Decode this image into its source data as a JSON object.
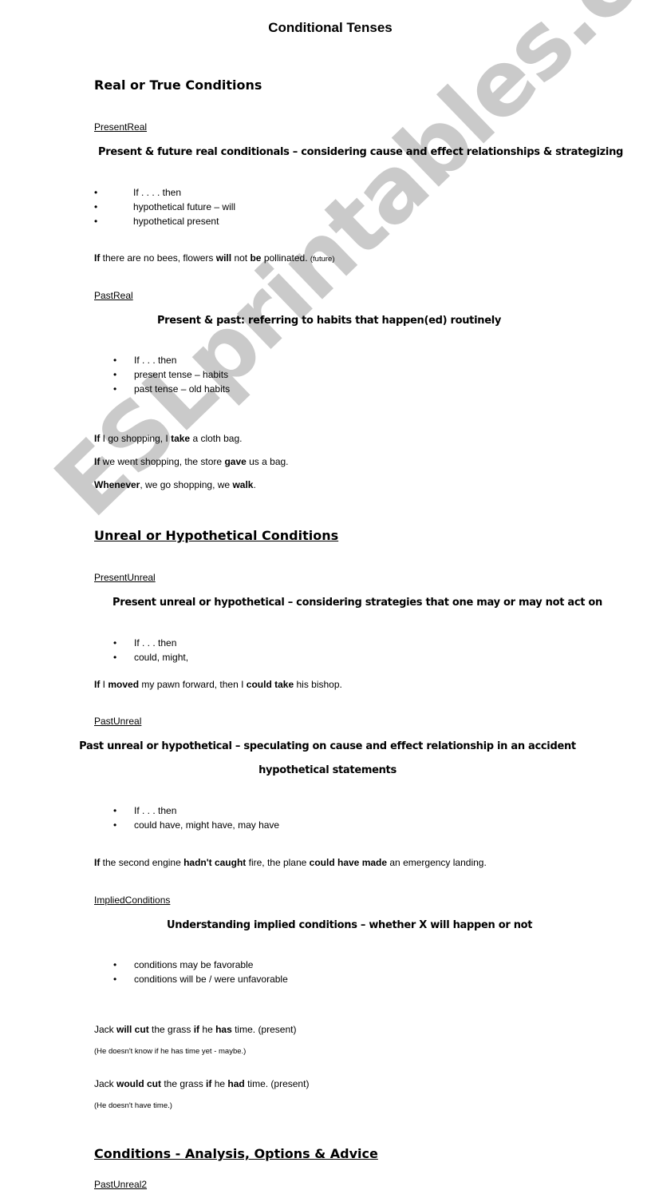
{
  "watermark": "ESLprintables.com",
  "title": "Conditional Tenses",
  "sections": {
    "real": {
      "heading": "Real or True Conditions",
      "present_real": {
        "link": "PresentReal",
        "desc": "Present & future real conditionals – considering cause and effect relationships & strategizing",
        "bullets": [
          "If . . . . then",
          "hypothetical future – will",
          "hypothetical present"
        ],
        "example": {
          "b1": "If",
          "t1": " there are no bees, flowers ",
          "b2": "will",
          "t2": " not ",
          "b3": "be",
          "t3": " pollinated. ",
          "note": "(future)"
        }
      },
      "past_real": {
        "link": "PastReal",
        "desc": "Present & past: referring to habits that happen(ed) routinely",
        "bullets": [
          "If  . . . then",
          "present tense – habits",
          "past tense – old habits"
        ],
        "examples": [
          {
            "b1": "If",
            "t1": " I go shopping, I ",
            "b2": "take",
            "t2": " a cloth bag."
          },
          {
            "b1": "If",
            "t1": " we went shopping, the store ",
            "b2": "gave",
            "t2": " us a bag."
          },
          {
            "b1": "Whenever",
            "t1": ", we go shopping, we ",
            "b2": "walk",
            "t2": "."
          }
        ]
      }
    },
    "unreal": {
      "heading": "Unreal or Hypothetical Conditions",
      "present_unreal": {
        "link": "PresentUnreal",
        "desc": "Present unreal or hypothetical – considering strategies that one may or may not act on",
        "bullets": [
          "If  . . . then",
          "could, might,"
        ],
        "example": {
          "b1": "If",
          "t1": " I ",
          "b2": "moved",
          "t2": " my pawn forward, then I ",
          "b3": "could take",
          "t3": " his bishop."
        }
      },
      "past_unreal": {
        "link": "PastUnreal",
        "desc_line1": "Past unreal or hypothetical – speculating on cause and effect relationship in an accident",
        "desc_line2": "hypothetical statements",
        "bullets": [
          "If  . . . then",
          "could have, might have, may have"
        ],
        "example": {
          "b1": "If",
          "t1": " the second engine ",
          "b2": "hadn't caught",
          "t2": " fire, the plane ",
          "b3": "could have made",
          "t3": " an emergency landing."
        }
      },
      "implied": {
        "link": "ImpliedConditions",
        "desc": "Understanding implied conditions – whether X will happen or not",
        "bullets": [
          "conditions may be favorable",
          "conditions will be / were unfavorable"
        ],
        "examples": [
          {
            "t0": "Jack ",
            "b1": "will cut",
            "t1": " the grass ",
            "b2": "if",
            "t2": " he ",
            "b3": "has",
            "t3": " time. (present)",
            "note": "(He doesn't know if he has time yet - maybe.)"
          },
          {
            "t0": "Jack ",
            "b1": "would cut",
            "t1": " the grass ",
            "b2": "if",
            "t2": " he ",
            "b3": "had",
            "t3": " time. (present)",
            "note": "(He doesn't have time.)"
          }
        ]
      }
    },
    "analysis": {
      "heading": "Conditions - Analysis, Options & Advice",
      "link": "PastUnreal2"
    }
  }
}
